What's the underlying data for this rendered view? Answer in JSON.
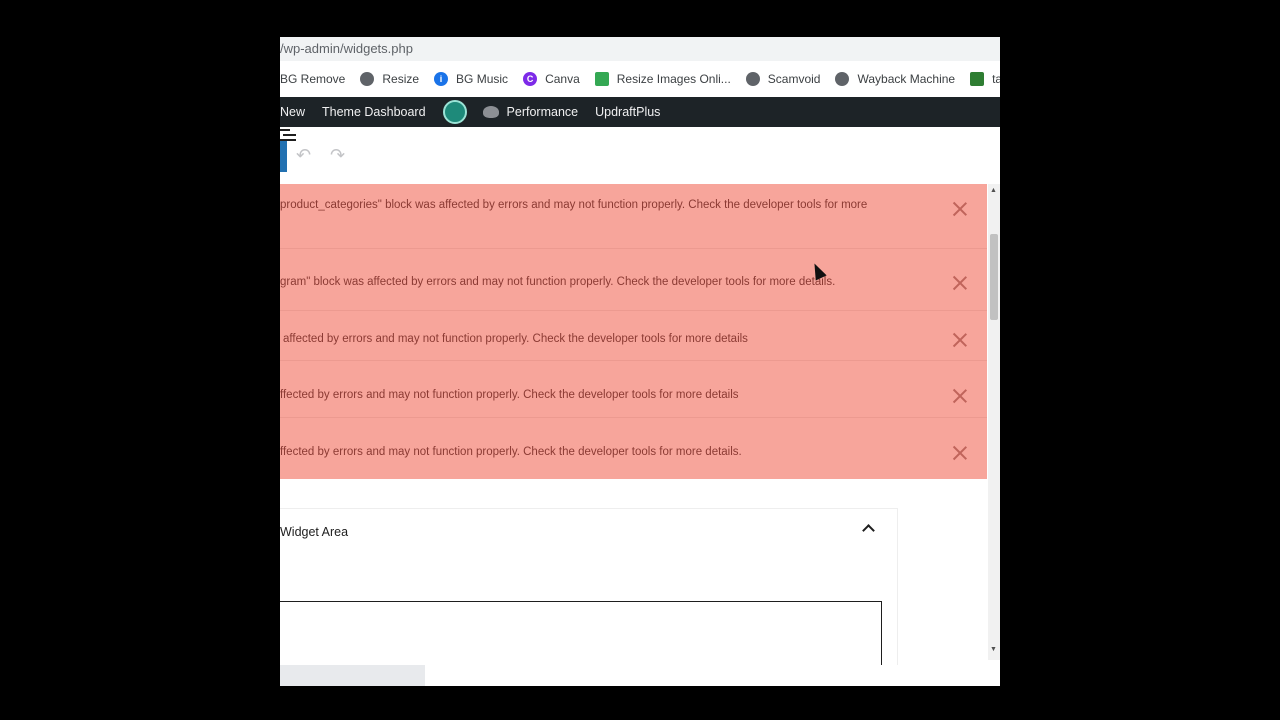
{
  "browser": {
    "url": "/wp-admin/widgets.php",
    "bookmarks": [
      {
        "label": "BG Remove",
        "icon": "none"
      },
      {
        "label": "Resize",
        "icon": "globe-icon"
      },
      {
        "label": "BG Music",
        "icon": "bg-music-icon"
      },
      {
        "label": "Canva",
        "icon": "canva-icon"
      },
      {
        "label": "Resize Images Onli...",
        "icon": "resize-images-icon"
      },
      {
        "label": "Scamvoid",
        "icon": "globe-icon"
      },
      {
        "label": "Wayback Machine",
        "icon": "globe-icon"
      },
      {
        "label": "tawk",
        "icon": "tawk-icon"
      }
    ]
  },
  "admin_bar": {
    "new_label": "New",
    "theme_dashboard": "Theme Dashboard",
    "performance": "Performance",
    "updraftplus": "UpdraftPlus"
  },
  "toolbar": {
    "undo_icon": "↶",
    "redo_icon": "↷"
  },
  "notices": [
    {
      "text": "product_categories\" block was affected by errors and may not function properly. Check the developer tools for more"
    },
    {
      "text": "gram\" block was affected by errors and may not function properly. Check the developer tools for more details."
    },
    {
      "text": "affected by errors and may not function properly. Check the developer tools for more details"
    },
    {
      "text": "ffected by errors and may not function properly. Check the developer tools for more details"
    },
    {
      "text": "ffected by errors and may not function properly. Check the developer tools for more details."
    }
  ],
  "widget_area": {
    "title": "Widget Area"
  },
  "colors": {
    "notice_bg": "#f7a59b",
    "admin_bar_bg": "#1d2327",
    "accent": "#2271b1"
  }
}
